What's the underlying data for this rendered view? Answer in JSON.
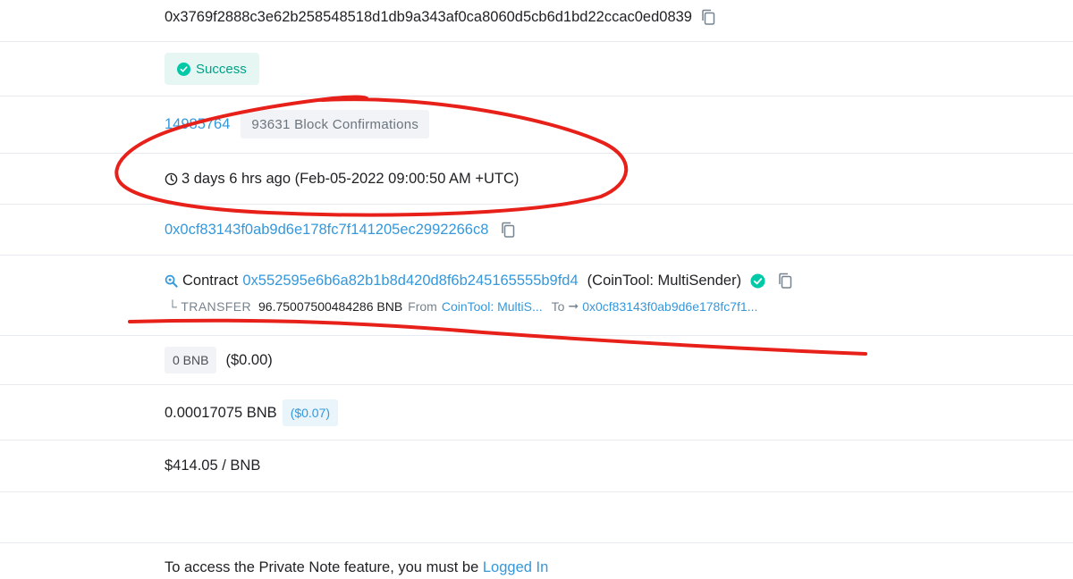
{
  "tx_hash": "0x3769f2888c3e62b258548518d1db9a343af0ca8060d5cb6d1bd22ccac0ed0839",
  "status": {
    "label": "Success",
    "icon": "check-circle-icon"
  },
  "block": {
    "number": "14985764",
    "confirmations": "93631 Block Confirmations"
  },
  "timestamp": {
    "icon": "clock-icon",
    "text": "3 days 6 hrs ago (Feb-05-2022 09:00:50 AM +UTC)"
  },
  "from_address": "0x0cf83143f0ab9d6e178fc7f141205ec2992266c8",
  "to": {
    "icon": "magnifier-icon",
    "prefix": "Contract",
    "address": "0x552595e6b6a82b1b8d420d8f6b245165555b9fd4",
    "name": "(CoinTool: MultiSender)",
    "verified_icon": "check-circle-icon"
  },
  "transfer": {
    "label": "└ TRANSFER",
    "amount": "96.75007500484286 BNB",
    "from_label": "From",
    "from_value": "CoinTool: MultiS...",
    "to_label": "To",
    "arrow": "➞",
    "to_value": "0x0cf83143f0ab9d6e178fc7f1..."
  },
  "value": {
    "amount": "0 BNB",
    "usd": "($0.00)"
  },
  "fee": {
    "amount": "0.00017075 BNB",
    "usd": "($0.07)"
  },
  "gas_price": "$414.05 / BNB",
  "private_note": {
    "text": "To access the Private Note feature, you must be ",
    "link": "Logged In"
  },
  "colors": {
    "link": "#3498db",
    "success": "#00c9a7",
    "annotation": "#e8201a"
  }
}
